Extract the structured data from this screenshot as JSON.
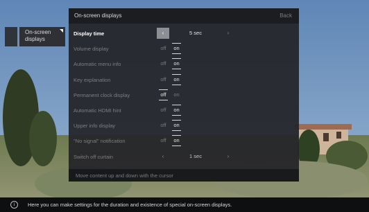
{
  "side_tab": {
    "label": "On-screen displays"
  },
  "panel": {
    "title": "On-screen displays",
    "back_label": "Back",
    "footer_hint": "Move content up and down with the cursor"
  },
  "settings": [
    {
      "label": "Display time",
      "type": "stepper",
      "value": "5 sec",
      "prev": "‹",
      "next": "›",
      "active": true
    },
    {
      "label": "Volume display",
      "type": "toggle",
      "off": "off",
      "on": "on",
      "selected": "on"
    },
    {
      "label": "Automatic menu info",
      "type": "toggle",
      "off": "off",
      "on": "on",
      "selected": "on"
    },
    {
      "label": "Key explanation",
      "type": "toggle",
      "off": "off",
      "on": "on",
      "selected": "on"
    },
    {
      "label": "Permanent clock display",
      "type": "toggle",
      "off": "off",
      "on": "on",
      "selected": "off"
    },
    {
      "label": "Automatic HDMI hint",
      "type": "toggle",
      "off": "off",
      "on": "on",
      "selected": "on"
    },
    {
      "label": "Upper info display",
      "type": "toggle",
      "off": "off",
      "on": "on",
      "selected": "on"
    },
    {
      "label": "\"No signal\" notification",
      "type": "toggle",
      "off": "off",
      "on": "on",
      "selected": "on"
    },
    {
      "label": "Switch off curtain",
      "type": "stepper",
      "value": "1 sec",
      "prev": "‹",
      "next": "›",
      "active": false
    }
  ],
  "info_bar": {
    "icon": "info-icon",
    "text": "Here you can make settings for the duration and existence of special on-screen displays."
  }
}
